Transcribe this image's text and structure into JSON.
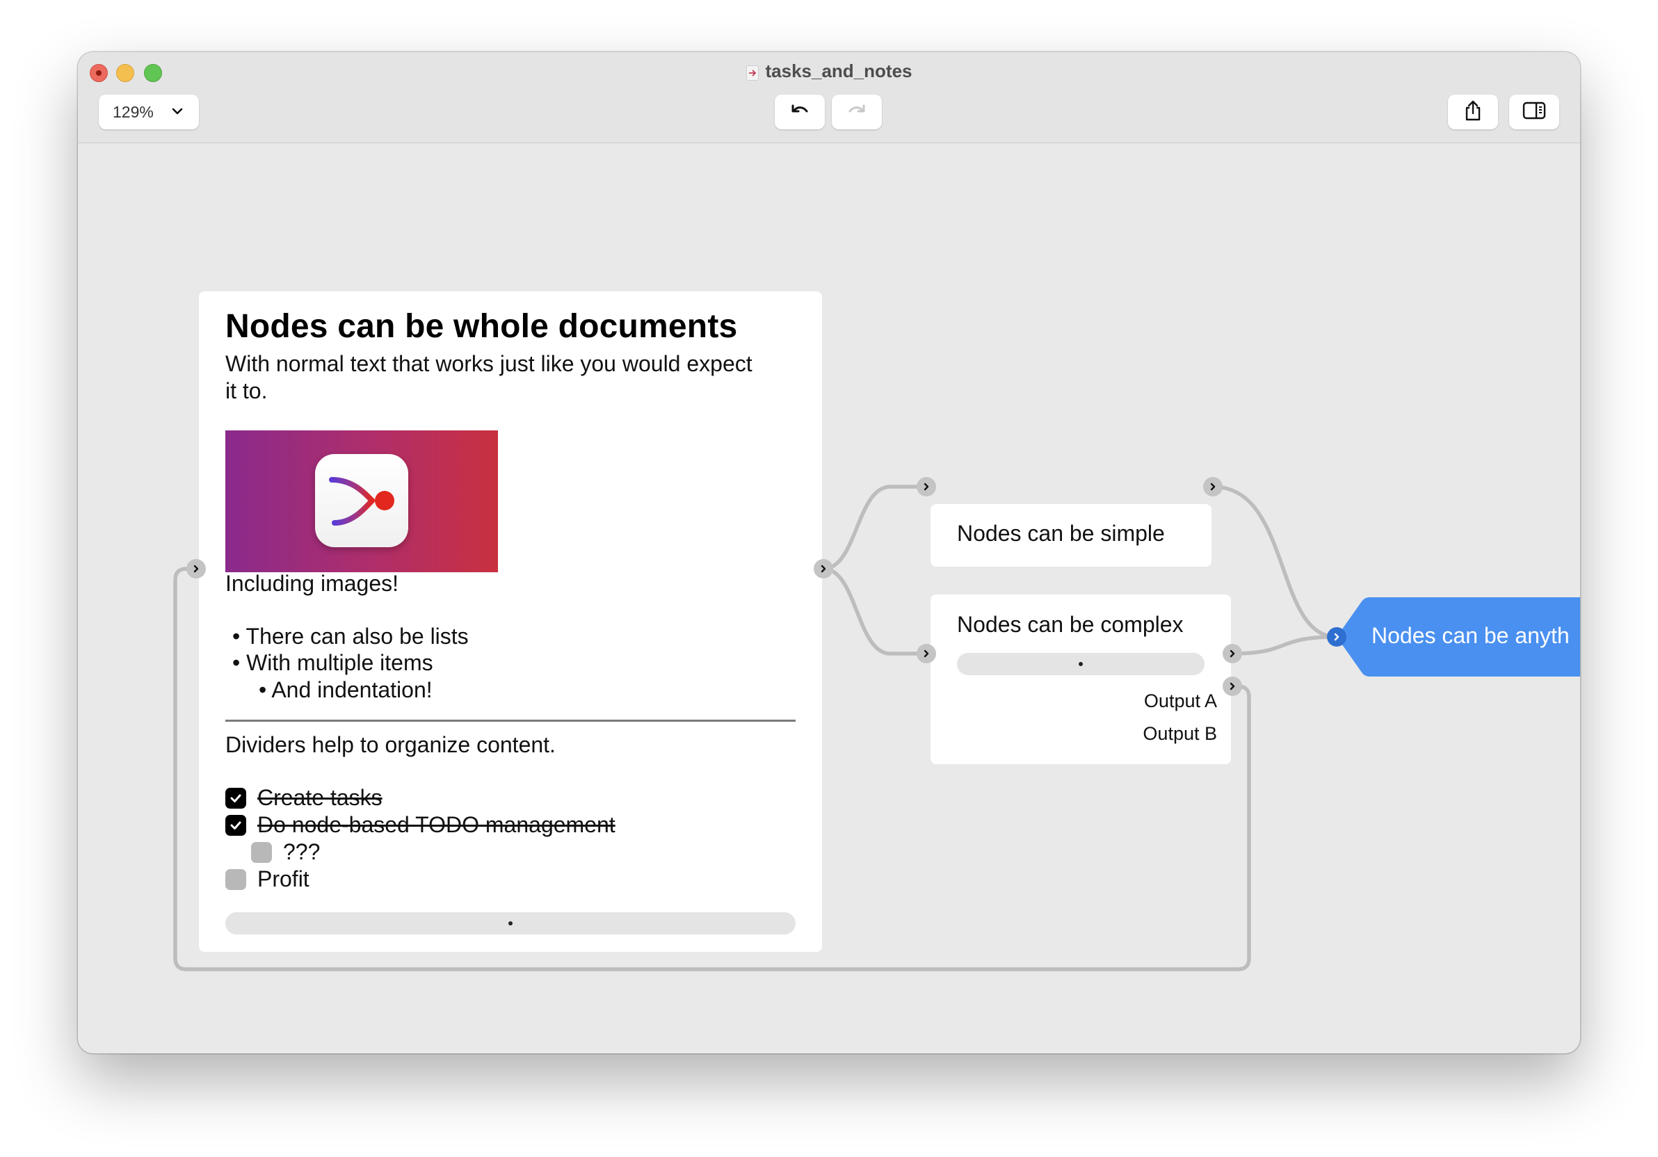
{
  "window": {
    "title": "tasks_and_notes"
  },
  "toolbar": {
    "zoom_value": "129%",
    "undo_icon": "undo-arrow",
    "redo_icon": "redo-arrow",
    "share_icon": "share-box-arrow",
    "sidebar_icon": "sidebar-panel"
  },
  "doc_node": {
    "title": "Nodes can be whole documents",
    "subtitle": "With normal text that works just like you would expect it to.",
    "image_caption": "Including images!",
    "bullets": [
      {
        "text": "There can also be lists",
        "level": 1
      },
      {
        "text": "With multiple items",
        "level": 1
      },
      {
        "text": "And indentation!",
        "level": 2
      }
    ],
    "divider_text": "Dividers help to organize content.",
    "tasks": [
      {
        "text": "Create tasks",
        "checked": true,
        "level": 1
      },
      {
        "text": "Do node-based TODO management",
        "checked": true,
        "level": 1
      },
      {
        "text": "???",
        "checked": false,
        "level": 2
      },
      {
        "text": "Profit",
        "checked": false,
        "level": 1
      }
    ]
  },
  "simple_node": {
    "label": "Nodes can be simple"
  },
  "complex_node": {
    "label": "Nodes can be complex",
    "outputs": [
      "Output A",
      "Output B"
    ]
  },
  "blue_node": {
    "label": "Nodes can be anyth",
    "color": "#4a90f0"
  },
  "colors": {
    "wire": "#bdbdbd",
    "canvas": "#e9e9e9",
    "accent_blue": "#4a90f0"
  }
}
